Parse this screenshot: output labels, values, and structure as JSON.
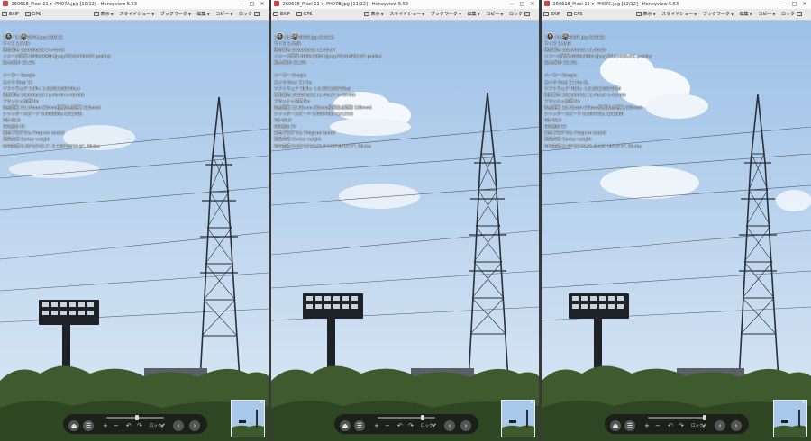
{
  "windows": [
    {
      "title": "260618_Pixel 11 > PH07A.jpg [10/12] - Honeyview 5.53",
      "toolbar": {
        "exif": "EXIF",
        "gps": "GPS",
        "view": "表示",
        "slideshow": "スライドショー",
        "bookmark": "ブックマーク",
        "edit": "編集",
        "copy": "コピー",
        "lock": "ロック"
      },
      "exif_lines": [
        "ファイル名 PH07A.jpg (10/12)",
        "サイズ 2.8MB",
        "更新日時 2026/06/18 11:46:09",
        "イメージ情報 4080x3060 (Jpeg,YCbCr420,ICC profile)",
        "拡大/縮小 23.2%",
        "",
        "メーカー Google",
        "カメラ Pixel 11",
        "ソフトウェア HDR+ 1.0.581168750ad",
        "撮影日時 2026/06/18 11:46:09 (+09:00)",
        "フラッシュ使用 No",
        "焦点距離 14.14mm (35mm換算焦点距離 115mm)",
        "シャッタースピード 0.000806s (1/1240)",
        "F値 f/2.8",
        "ISO感度 49",
        "露出プログラム Program (auto)",
        "測光方式 Center weight",
        "GPS座標 N 35°52'42.1\", E 139°50'18.6\", 28.0m"
      ],
      "controls": {
        "zoom_label": "ロック"
      },
      "thumb_close": "×"
    },
    {
      "title": "260618_Pixel 11 > PH07B.jpg [11/12] - Honeyview 5.53",
      "toolbar": {
        "exif": "EXIF",
        "gps": "GPS",
        "view": "表示",
        "slideshow": "スライドショー",
        "bookmark": "ブックマーク",
        "edit": "編集",
        "copy": "コピー",
        "lock": "ロック"
      },
      "exif_lines": [
        "ファイル名 PH07B.jpg (11/12)",
        "サイズ 2.4MB",
        "更新日時 2026/06/18 11:46:37",
        "イメージ情報 4080x3064 (Jpeg,YCbCr420,ICC profile)",
        "拡大/縮小 23.2%",
        "",
        "メーカー Google",
        "カメラ Pixel 11 Pro",
        "ソフトウェア HDR+ 1.0.581168750zd",
        "撮影日時 2026/06/18 11:46:37 (+09:00)",
        "フラッシュ使用 No",
        "焦点距離 15.62mm (35mm換算焦点距離 120mm)",
        "シャッタースピード 0.000798s (1/1253)",
        "F値 f/2.8",
        "ISO感度 37",
        "露出プログラム Program (auto)",
        "測光方式 Center weight",
        "GPS座標 N 35°52'43.8\", E 139°50'17.7\", 26.4m"
      ],
      "controls": {
        "zoom_label": "ロック"
      },
      "thumb_close": "×"
    },
    {
      "title": "260618_Pixel 11 > PH07C.jpg [12/12] - Honeyview 5.53",
      "toolbar": {
        "exif": "EXIF",
        "gps": "GPS",
        "view": "表示",
        "slideshow": "スライドショー",
        "bookmark": "ブックマーク",
        "edit": "編集",
        "copy": "コピー",
        "lock": "ロック"
      },
      "exif_lines": [
        "ファイル名 PH07C.jpg (12/12)",
        "サイズ 2.5MB",
        "更新日時 2026/06/18 11:46:50",
        "イメージ情報 4080x3064 (Jpeg,YCbCr420,ICC profile)",
        "拡大/縮小 23.2%",
        "",
        "メーカー Google",
        "カメラ Pixel 11 Pro XL",
        "ソフトウェア HDR+ 1.0.581168750zd",
        "撮影日時 2026/06/18 11:46:50 (+09:00)",
        "フラッシュ使用 No",
        "焦点距離 15.62mm (35mm換算焦点距離 120mm)",
        "シャッタースピード 0.000781s (1/1280)",
        "F値 f/2.8",
        "ISO感度 33",
        "露出プログラム Program (auto)",
        "測光方式 Center weight",
        "GPS座標 N 35°52'43.8\", E 139°50'17.7\", 26.4m"
      ],
      "controls": {
        "zoom_label": "ロック"
      },
      "thumb_close": "×"
    }
  ],
  "titlebar_controls": {
    "minimize": "—",
    "maximize": "□",
    "close": "✕"
  },
  "control_icons": {
    "eject": "⏏",
    "menu": "☰",
    "zoom_in": "+",
    "zoom_out": "−",
    "rotate_left": "↶",
    "rotate_right": "↷",
    "prev": "‹",
    "next": "›",
    "info": "ⓘ",
    "settings": "⚙"
  },
  "colors": {
    "sky_top": "#a8c8ea",
    "sky_bottom": "#d9e8f5",
    "tower": "#2b2f36",
    "tree": "#3f5a2c",
    "control_bar": "#1a1a1a"
  }
}
